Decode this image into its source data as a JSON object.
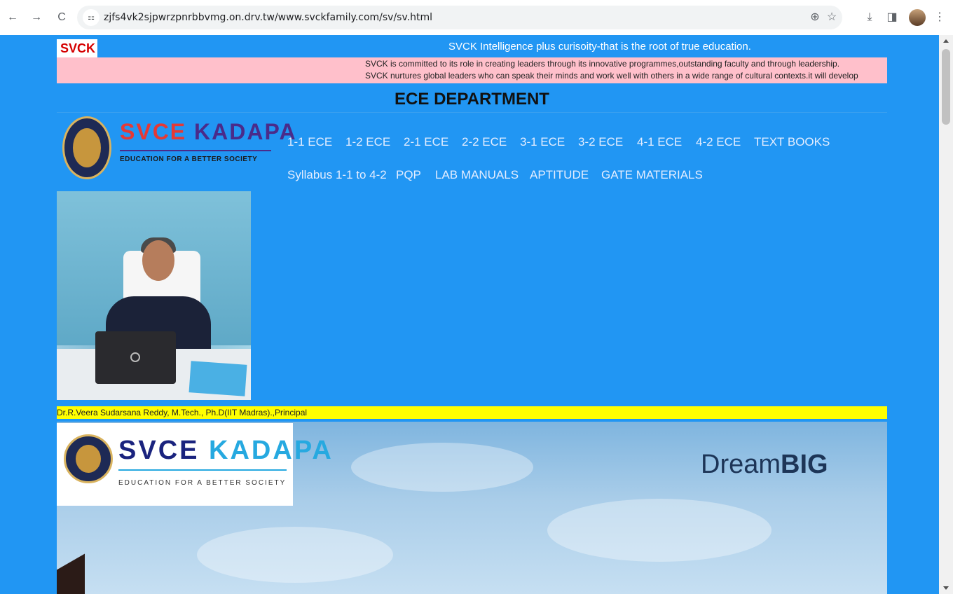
{
  "browser": {
    "url": "zjfs4vk2sjpwrzpnrbbvmg.on.drv.tw/www.svckfamily.com/sv/sv.html",
    "nav_back": "←",
    "nav_forward": "→",
    "nav_reload": "C",
    "site_info_icon": "⚏",
    "icons": {
      "zoom": "zoom-icon",
      "bookmark": "star-icon",
      "download": "download-icon",
      "sidebar": "sidebar-icon",
      "profile": "avatar",
      "menu": "kebab-menu-icon"
    },
    "zoom_glyph": "⊕",
    "bookmark_glyph": "☆",
    "download_glyph": "⤓",
    "sidebar_glyph": "◨",
    "menu_glyph": "⋮"
  },
  "top": {
    "svck_label": "SVCK",
    "marquee": "SVCK Intelligence plus curisoity-that is the root of true education.",
    "mission_line_1": "SVCK is committed to its role in creating leaders through its innovative programmes,outstanding faculty and through leadership.",
    "mission_line_2": "SVCK nurtures global leaders who can speak their minds and work well with others in a wide range of cultural contexts.it will develop"
  },
  "department_title": "ECE DEPARTMENT",
  "logo": {
    "brand_part_1": "SVCE ",
    "brand_part_2": "KADAPA",
    "tagline": "EDUCATION FOR A BETTER SOCIETY"
  },
  "menu": {
    "row1": [
      "1-1 ECE",
      "1-2 ECE",
      "2-1 ECE",
      "2-2 ECE",
      "3-1 ECE",
      "3-2 ECE",
      "4-1 ECE",
      "4-2 ECE",
      "TEXT BOOKS"
    ],
    "row2": [
      "Syllabus 1-1 to 4-2",
      "PQP",
      "LAB MANUALS",
      "APTITUDE",
      "GATE MATERIALS"
    ]
  },
  "principal": {
    "caption": "Dr.R.Veera Sudarsana Reddy, M.Tech., Ph.D(IIT Madras).,Principal"
  },
  "banner": {
    "brand_part_1": "SVCE ",
    "brand_part_2": "KADAPA",
    "tagline": "EDUCATION FOR A BETTER SOCIETY",
    "dream_part_1": "Dream",
    "dream_part_2": "BIG"
  },
  "colors": {
    "page_bg": "#2196f3",
    "pink_bar": "#ffc0cb",
    "caption_bar": "#ffff00",
    "svck_red": "#d50000"
  }
}
